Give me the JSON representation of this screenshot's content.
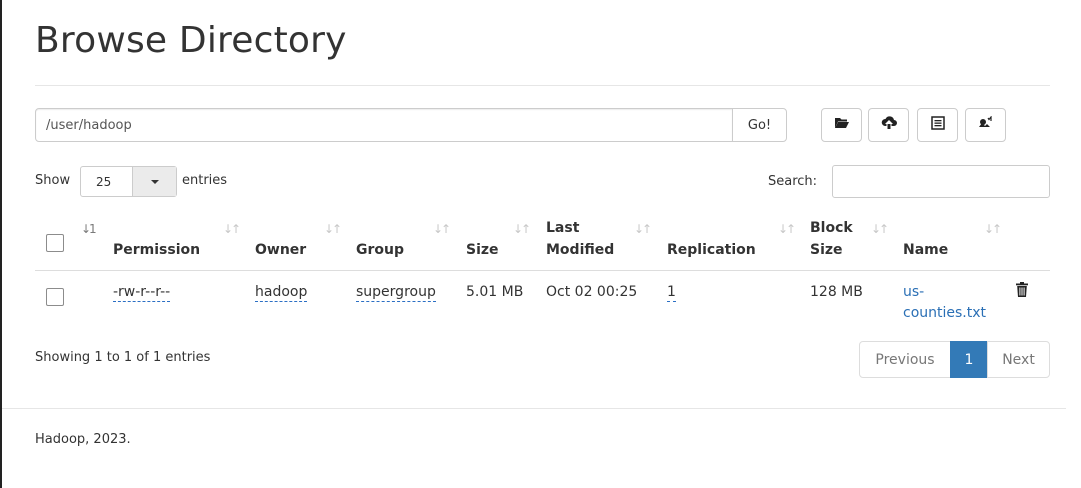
{
  "page": {
    "title": "Browse Directory"
  },
  "path_bar": {
    "value": "/user/hadoop",
    "go_label": "Go!"
  },
  "toolbar": {
    "icons": [
      "folder-open-icon",
      "upload-icon",
      "list-alt-icon",
      "paste-icon"
    ]
  },
  "table_controls": {
    "show_label": "Show",
    "page_length": "25",
    "entries_label": "entries",
    "search_label": "Search:",
    "search_value": ""
  },
  "table": {
    "columns": [
      "Permission",
      "Owner",
      "Group",
      "Size",
      "Last",
      "Modified",
      "Replication",
      "Block",
      "Size",
      "Name"
    ],
    "rows": [
      {
        "permission": "-rw-r--r--",
        "owner": "hadoop",
        "group": "supergroup",
        "size": "5.01 MB",
        "last_modified": "Oct 02 00:25",
        "replication": "1",
        "block_size": "128 MB",
        "name_line1": "us-",
        "name_line2": "counties.txt"
      }
    ]
  },
  "info": {
    "text": "Showing 1 to 1 of 1 entries"
  },
  "pagination": {
    "previous": "Previous",
    "current": "1",
    "next": "Next"
  },
  "footer": {
    "text": "Hadoop, 2023."
  },
  "colors": {
    "accent": "#337ab7",
    "link": "#2a6fb5"
  }
}
